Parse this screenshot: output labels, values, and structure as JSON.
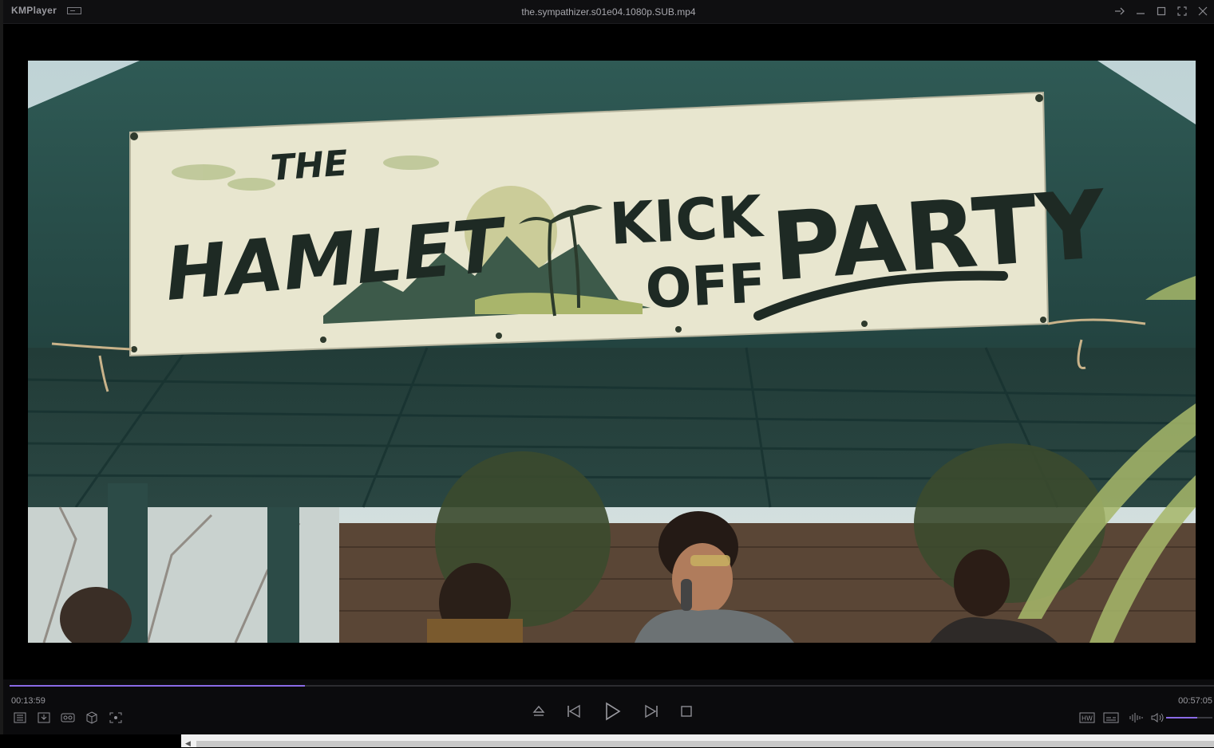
{
  "window": {
    "app_name": "KMPlayer",
    "file_title": "the.sympathizer.s01e04.1080p.SUB.mp4",
    "controls": [
      "pin-icon",
      "minimize-icon",
      "maximize-icon",
      "fullscreen-icon",
      "close-icon"
    ]
  },
  "video": {
    "banner_line1": "THE",
    "banner_line2": "HAMLET",
    "banner_line3": "KICK",
    "banner_line4": "OFF",
    "banner_line5": "PARTY"
  },
  "playback": {
    "current_time": "00:13:59",
    "total_time": "00:57:05",
    "progress": 0.245,
    "volume": 0.68,
    "accent_color": "#8a6ae6"
  },
  "left_tools": [
    "playlist-icon",
    "download-icon",
    "vr-icon",
    "3d-icon",
    "capture-icon"
  ],
  "center_controls": [
    "eject-icon",
    "previous-icon",
    "play-icon",
    "next-icon",
    "stop-icon"
  ],
  "right_tools": [
    "hw-icon",
    "subtitle-icon",
    "equalizer-icon",
    "volume-icon"
  ],
  "labels": {
    "hw": "HW"
  }
}
